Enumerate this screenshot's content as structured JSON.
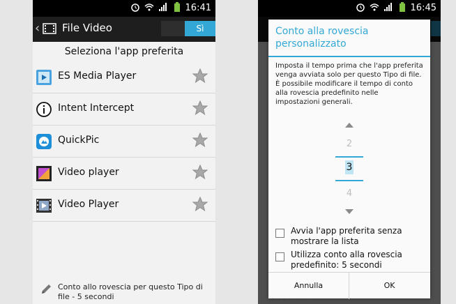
{
  "left": {
    "status_time": "16:41",
    "title": "File Video",
    "toggle_on": "Sì",
    "subtitle": "Seleziona l'app preferita",
    "apps": [
      {
        "name": "ES Media Player",
        "icon": "es-media-player-icon"
      },
      {
        "name": "Intent Intercept",
        "icon": "info-icon"
      },
      {
        "name": "QuickPic",
        "icon": "quickpic-icon"
      },
      {
        "name": "Video player",
        "icon": "video-player-icon"
      },
      {
        "name": "Video Player",
        "icon": "video-film-icon"
      }
    ],
    "footer_text": "Conto allo rovescia per questo Tipo di file - 5 secondi"
  },
  "right": {
    "status_time": "16:45",
    "dialog": {
      "title": "Conto alla rovescia personalizzato",
      "message": "Imposta il tempo prima che l'app preferita venga avviata solo per questo Tipo di file. È possibile modificare il tempo di conto alla rovescia predefinito nelle impostazioni generali.",
      "picker": {
        "prev": "2",
        "current": "3",
        "next": "4"
      },
      "option1": "Avvia l'app preferita senza mostrare la lista",
      "option2": "Utilizza conto alla rovescia predefinito: 5 secondi",
      "cancel": "Annulla",
      "ok": "OK"
    },
    "under_text": "5 secondi"
  },
  "colors": {
    "accent": "#33a8d6",
    "statusbar": "#000000",
    "actionbar": "#1e1e1e"
  }
}
